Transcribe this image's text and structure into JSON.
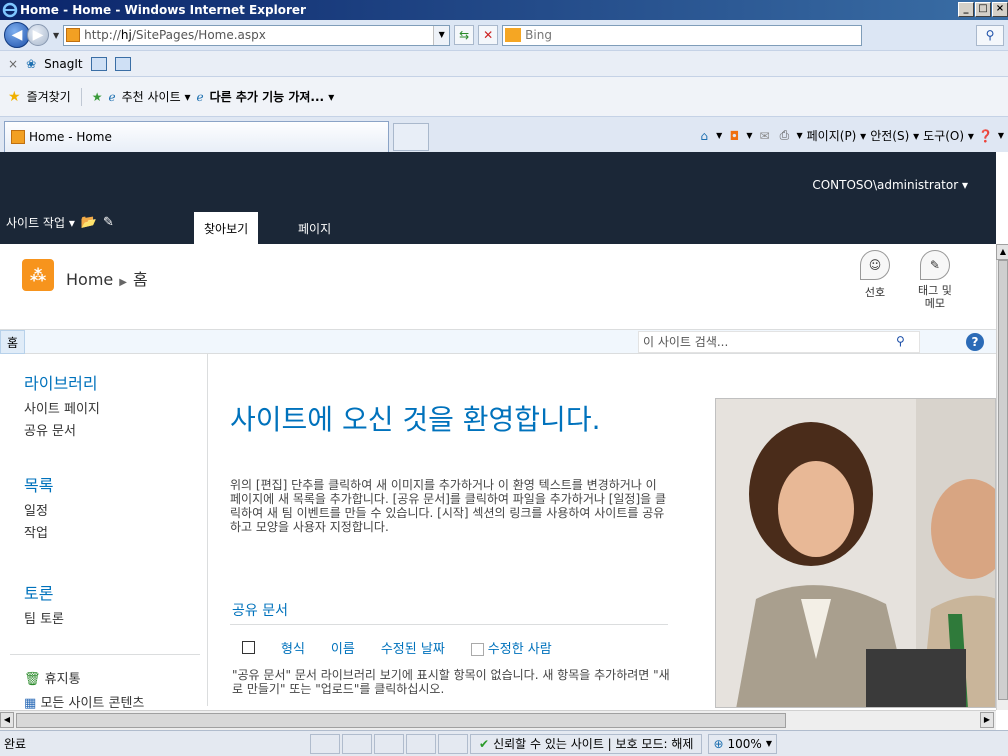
{
  "window": {
    "title": "Home - Home - Windows Internet Explorer",
    "min": "_",
    "max": "□",
    "close": "×"
  },
  "address": {
    "url_prefix": "http://",
    "url_host": "hj",
    "url_path": "/SitePages/Home.aspx"
  },
  "search_provider": "Bing",
  "snagit": {
    "close": "×",
    "label": "SnagIt"
  },
  "favorites": {
    "label": "즐겨찾기",
    "suggested": "추천 사이트 ▾",
    "more_addons": "다른 추가 기능 가져... ▾"
  },
  "tab": {
    "label": "Home - Home"
  },
  "commandbar": {
    "page": "페이지(P) ▾",
    "safety": "안전(S) ▾",
    "tools": "도구(O) ▾"
  },
  "sharepoint": {
    "user": "CONTOSO\\administrator ▾",
    "site_actions": "사이트 작업 ▾",
    "tabs": [
      "찾아보기",
      "페이지"
    ],
    "breadcrumb_site": "Home",
    "breadcrumb_page": "홈",
    "like_label": "선호",
    "tags_label": "태그 및\n메모",
    "topnav_home": "홈",
    "search_placeholder": "이 사이트 검색...",
    "quicklaunch": {
      "libraries": "라이브러리",
      "site_pages": "사이트 페이지",
      "shared_docs": "공유 문서",
      "lists": "목록",
      "calendar": "일정",
      "tasks": "작업",
      "discussions": "토론",
      "team_discussion": "팀 토론",
      "recycle_bin": "휴지통",
      "all_content": "모든 사이트 콘텐츠"
    },
    "welcome": "사이트에 오신 것을 환영합니다.",
    "description": "위의 [편집] 단추를 클릭하여 새 이미지를 추가하거나 이 환영 텍스트를 변경하거나 이 페이지에 새 목록을 추가합니다. [공유 문서]를 클릭하여 파일을 추가하거나 [일정]을 클릭하여 새 팀 이벤트를 만들 수 있습니다. [시작] 섹션의 링크를 사용하여 사이트를 공유하고 모양을 사용자 지정합니다.",
    "doclib": {
      "title": "공유 문서",
      "columns": [
        "형식",
        "이름",
        "수정된 날짜",
        "수정한 사람"
      ],
      "empty": "\"공유 문서\" 문서 라이브러리 보기에 표시할 항목이 없습니다. 새 항목을 추가하려면 \"새로 만들기\" 또는 \"업로드\"를 클릭하십시오."
    }
  },
  "status": {
    "text": "완료",
    "trust": "신뢰할 수 있는 사이트 | 보호 모드: 해제",
    "zoom": "100%"
  }
}
